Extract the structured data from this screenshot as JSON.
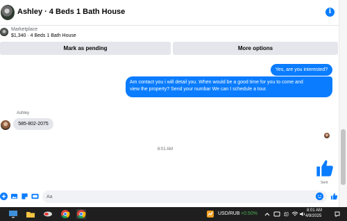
{
  "header": {
    "title": "Ashley · 4 Beds 1 Bath House",
    "info_icon": "info-icon"
  },
  "listing": {
    "source": "Marketplace",
    "price_title": "$1,340 · 4 Beds 1 Bath House"
  },
  "actions": {
    "mark_pending": "Mark as pending",
    "more_options": "More options"
  },
  "messages": {
    "outgoing_1": "Yes, are you interested?",
    "outgoing_2_lines": [
      "Am contact you i will detail you.  When would be a good time for you to come and",
      "view the property? Send your numbar We can I schedule a tour."
    ],
    "sender_name": "Ashley",
    "incoming_1": "585-802-2075",
    "timestamp": "8:01 AM",
    "sent_status": "Sent"
  },
  "composer": {
    "placeholder": "Aa",
    "icons": [
      "plus-circle-icon",
      "image-icon",
      "sticker-icon",
      "gif-icon",
      "emoji-icon",
      "like-icon"
    ]
  },
  "taskbar": {
    "ticker_label": "USD/RUB",
    "ticker_change": "+0.50%",
    "time": "8:01 AM",
    "date": "4/9/2025"
  },
  "colors": {
    "messenger_blue": "#0a7cff",
    "bubble_gray": "#e4e6eb",
    "ticker_green": "#4caf50",
    "taskbar_bg": "#1f1f1f"
  }
}
